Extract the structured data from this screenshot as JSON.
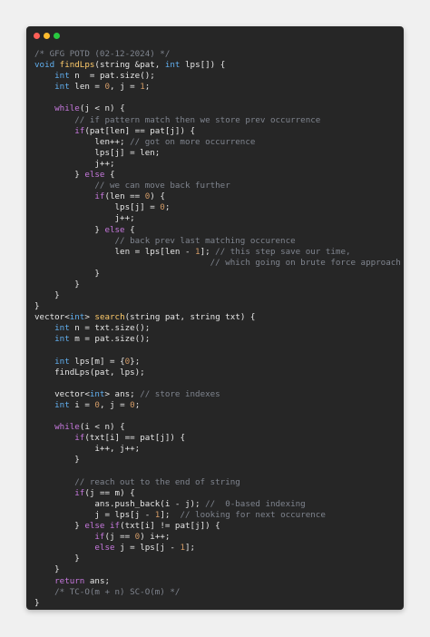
{
  "window": {
    "controls": [
      "close",
      "minimize",
      "maximize"
    ]
  },
  "code_lines": [
    [
      {
        "t": "/* GFG POTD (02-12-2024) */",
        "c": "cm"
      }
    ],
    [
      {
        "t": "void ",
        "c": "type"
      },
      {
        "t": "findLps",
        "c": "fn"
      },
      {
        "t": "(string &pat, ",
        "c": "plain"
      },
      {
        "t": "int",
        "c": "type"
      },
      {
        "t": " lps[]) {",
        "c": "plain"
      }
    ],
    [
      {
        "t": "    ",
        "c": "plain"
      },
      {
        "t": "int",
        "c": "type"
      },
      {
        "t": " n  = pat.size();",
        "c": "plain"
      }
    ],
    [
      {
        "t": "    ",
        "c": "plain"
      },
      {
        "t": "int",
        "c": "type"
      },
      {
        "t": " len = ",
        "c": "plain"
      },
      {
        "t": "0",
        "c": "num"
      },
      {
        "t": ", j = ",
        "c": "plain"
      },
      {
        "t": "1",
        "c": "num"
      },
      {
        "t": ";",
        "c": "plain"
      }
    ],
    [
      {
        "t": "",
        "c": "plain"
      }
    ],
    [
      {
        "t": "    ",
        "c": "plain"
      },
      {
        "t": "while",
        "c": "kw"
      },
      {
        "t": "(j < n) {",
        "c": "plain"
      }
    ],
    [
      {
        "t": "        ",
        "c": "plain"
      },
      {
        "t": "// if pattern match then we store prev occurrence",
        "c": "cm"
      }
    ],
    [
      {
        "t": "        ",
        "c": "plain"
      },
      {
        "t": "if",
        "c": "kw"
      },
      {
        "t": "(pat[len] == pat[j]) {",
        "c": "plain"
      }
    ],
    [
      {
        "t": "            len++; ",
        "c": "plain"
      },
      {
        "t": "// got on more occurrence",
        "c": "cm"
      }
    ],
    [
      {
        "t": "            lps[j] = len;",
        "c": "plain"
      }
    ],
    [
      {
        "t": "            j++;",
        "c": "plain"
      }
    ],
    [
      {
        "t": "        } ",
        "c": "plain"
      },
      {
        "t": "else",
        "c": "kw"
      },
      {
        "t": " {",
        "c": "plain"
      }
    ],
    [
      {
        "t": "            ",
        "c": "plain"
      },
      {
        "t": "// we can move back further",
        "c": "cm"
      }
    ],
    [
      {
        "t": "            ",
        "c": "plain"
      },
      {
        "t": "if",
        "c": "kw"
      },
      {
        "t": "(len == ",
        "c": "plain"
      },
      {
        "t": "0",
        "c": "num"
      },
      {
        "t": ") {",
        "c": "plain"
      }
    ],
    [
      {
        "t": "                lps[j] = ",
        "c": "plain"
      },
      {
        "t": "0",
        "c": "num"
      },
      {
        "t": ";",
        "c": "plain"
      }
    ],
    [
      {
        "t": "                j++;",
        "c": "plain"
      }
    ],
    [
      {
        "t": "            } ",
        "c": "plain"
      },
      {
        "t": "else",
        "c": "kw"
      },
      {
        "t": " {",
        "c": "plain"
      }
    ],
    [
      {
        "t": "                ",
        "c": "plain"
      },
      {
        "t": "// back prev last matching occurence",
        "c": "cm"
      }
    ],
    [
      {
        "t": "                len = lps[len - ",
        "c": "plain"
      },
      {
        "t": "1",
        "c": "num"
      },
      {
        "t": "]; ",
        "c": "plain"
      },
      {
        "t": "// this step save our time,",
        "c": "cm"
      }
    ],
    [
      {
        "t": "                                   ",
        "c": "plain"
      },
      {
        "t": "// which going on brute force approach",
        "c": "cm"
      }
    ],
    [
      {
        "t": "            }",
        "c": "plain"
      }
    ],
    [
      {
        "t": "        }",
        "c": "plain"
      }
    ],
    [
      {
        "t": "    }",
        "c": "plain"
      }
    ],
    [
      {
        "t": "}",
        "c": "plain"
      }
    ],
    [
      {
        "t": "vector<",
        "c": "plain"
      },
      {
        "t": "int",
        "c": "type"
      },
      {
        "t": "> ",
        "c": "plain"
      },
      {
        "t": "search",
        "c": "fn"
      },
      {
        "t": "(string pat, string txt) {",
        "c": "plain"
      }
    ],
    [
      {
        "t": "    ",
        "c": "plain"
      },
      {
        "t": "int",
        "c": "type"
      },
      {
        "t": " n = txt.size();",
        "c": "plain"
      }
    ],
    [
      {
        "t": "    ",
        "c": "plain"
      },
      {
        "t": "int",
        "c": "type"
      },
      {
        "t": " m = pat.size();",
        "c": "plain"
      }
    ],
    [
      {
        "t": "",
        "c": "plain"
      }
    ],
    [
      {
        "t": "    ",
        "c": "plain"
      },
      {
        "t": "int",
        "c": "type"
      },
      {
        "t": " lps[m] = {",
        "c": "plain"
      },
      {
        "t": "0",
        "c": "num"
      },
      {
        "t": "};",
        "c": "plain"
      }
    ],
    [
      {
        "t": "    findLps(pat, lps);",
        "c": "plain"
      }
    ],
    [
      {
        "t": "",
        "c": "plain"
      }
    ],
    [
      {
        "t": "    vector<",
        "c": "plain"
      },
      {
        "t": "int",
        "c": "type"
      },
      {
        "t": "> ans; ",
        "c": "plain"
      },
      {
        "t": "// store indexes",
        "c": "cm"
      }
    ],
    [
      {
        "t": "    ",
        "c": "plain"
      },
      {
        "t": "int",
        "c": "type"
      },
      {
        "t": " i = ",
        "c": "plain"
      },
      {
        "t": "0",
        "c": "num"
      },
      {
        "t": ", j = ",
        "c": "plain"
      },
      {
        "t": "0",
        "c": "num"
      },
      {
        "t": ";",
        "c": "plain"
      }
    ],
    [
      {
        "t": "",
        "c": "plain"
      }
    ],
    [
      {
        "t": "    ",
        "c": "plain"
      },
      {
        "t": "while",
        "c": "kw"
      },
      {
        "t": "(i < n) {",
        "c": "plain"
      }
    ],
    [
      {
        "t": "        ",
        "c": "plain"
      },
      {
        "t": "if",
        "c": "kw"
      },
      {
        "t": "(txt[i] == pat[j]) {",
        "c": "plain"
      }
    ],
    [
      {
        "t": "            i++, j++;",
        "c": "plain"
      }
    ],
    [
      {
        "t": "        }",
        "c": "plain"
      }
    ],
    [
      {
        "t": "",
        "c": "plain"
      }
    ],
    [
      {
        "t": "        ",
        "c": "plain"
      },
      {
        "t": "// reach out to the end of string",
        "c": "cm"
      }
    ],
    [
      {
        "t": "        ",
        "c": "plain"
      },
      {
        "t": "if",
        "c": "kw"
      },
      {
        "t": "(j == m) {",
        "c": "plain"
      }
    ],
    [
      {
        "t": "            ans.push_back(i - j); ",
        "c": "plain"
      },
      {
        "t": "//  0-based indexing",
        "c": "cm"
      }
    ],
    [
      {
        "t": "            j = lps[j - ",
        "c": "plain"
      },
      {
        "t": "1",
        "c": "num"
      },
      {
        "t": "];  ",
        "c": "plain"
      },
      {
        "t": "// looking for next occurence",
        "c": "cm"
      }
    ],
    [
      {
        "t": "        } ",
        "c": "plain"
      },
      {
        "t": "else if",
        "c": "kw"
      },
      {
        "t": "(txt[i] != pat[j]) {",
        "c": "plain"
      }
    ],
    [
      {
        "t": "            ",
        "c": "plain"
      },
      {
        "t": "if",
        "c": "kw"
      },
      {
        "t": "(j == ",
        "c": "plain"
      },
      {
        "t": "0",
        "c": "num"
      },
      {
        "t": ") i++;",
        "c": "plain"
      }
    ],
    [
      {
        "t": "            ",
        "c": "plain"
      },
      {
        "t": "else",
        "c": "kw"
      },
      {
        "t": " j = lps[j - ",
        "c": "plain"
      },
      {
        "t": "1",
        "c": "num"
      },
      {
        "t": "];",
        "c": "plain"
      }
    ],
    [
      {
        "t": "        }",
        "c": "plain"
      }
    ],
    [
      {
        "t": "    }",
        "c": "plain"
      }
    ],
    [
      {
        "t": "    ",
        "c": "plain"
      },
      {
        "t": "return",
        "c": "kw"
      },
      {
        "t": " ans;",
        "c": "plain"
      }
    ],
    [
      {
        "t": "    ",
        "c": "plain"
      },
      {
        "t": "/* TC-O(m + n) SC-O(m) */",
        "c": "cm"
      }
    ],
    [
      {
        "t": "}",
        "c": "plain"
      }
    ]
  ]
}
